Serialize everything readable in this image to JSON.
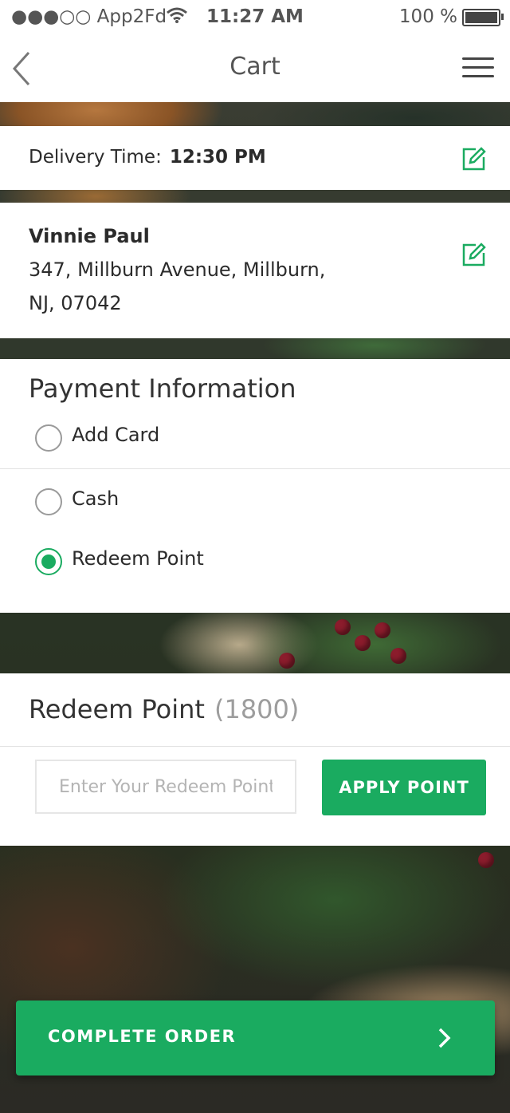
{
  "status_bar": {
    "carrier": "●●●○○ App2Fd",
    "time": "11:27 AM",
    "battery": "100 %"
  },
  "nav": {
    "title": "Cart"
  },
  "delivery": {
    "label": "Delivery Time:",
    "time": "12:30 PM"
  },
  "address": {
    "name": "Vinnie Paul",
    "line1": "347, Millburn Avenue, Millburn,",
    "line2": "NJ, 07042"
  },
  "payment": {
    "heading": "Payment Information",
    "options": [
      {
        "label": "Add Card",
        "selected": false
      },
      {
        "label": "Cash",
        "selected": false
      },
      {
        "label": "Redeem Point",
        "selected": true
      }
    ]
  },
  "redeem": {
    "heading": "Redeem Point",
    "points": "(1800)",
    "input_placeholder": "Enter Your Redeem Point",
    "apply_label": "APPLY POINT"
  },
  "complete_order": {
    "label": "COMPLETE ORDER"
  },
  "colors": {
    "accent": "#1aab60"
  }
}
